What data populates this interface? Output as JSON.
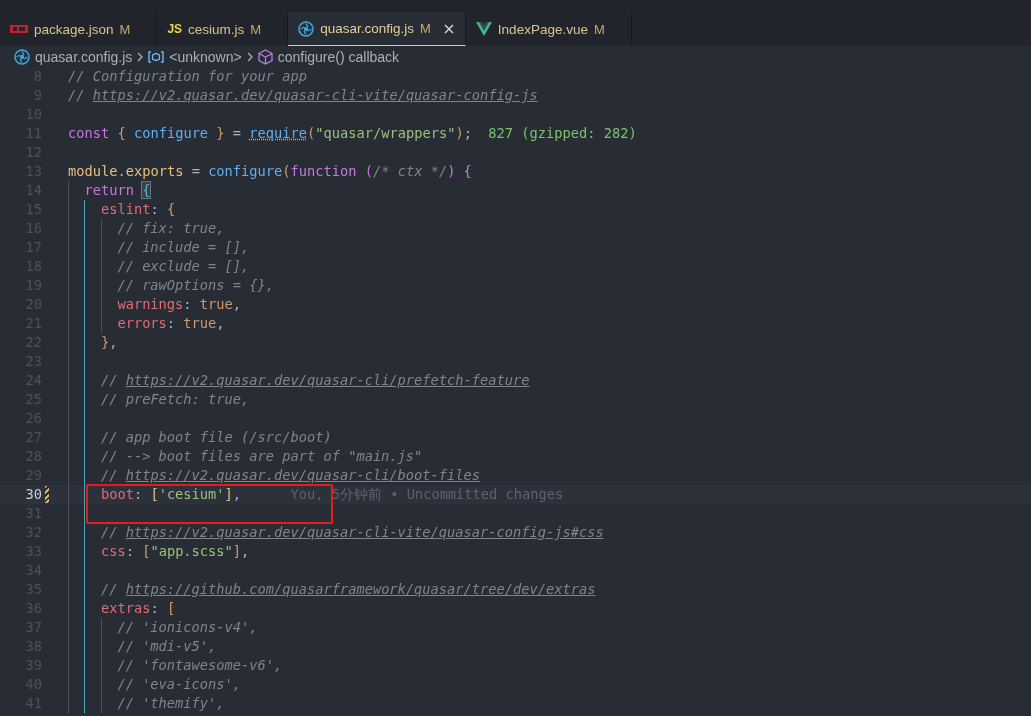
{
  "tabs": [
    {
      "label": "package.json",
      "status": "M",
      "kind": "package",
      "selected": false
    },
    {
      "label": "cesium.js",
      "status": "M",
      "kind": "js",
      "icon_text": "JS",
      "selected": false
    },
    {
      "label": "quasar.config.js",
      "status": "M",
      "kind": "swirl",
      "selected": true
    },
    {
      "label": "IndexPage.vue",
      "status": "M",
      "kind": "vue",
      "selected": false
    }
  ],
  "breadcrumb": [
    {
      "label": "quasar.config.js",
      "kind": "swirl"
    },
    {
      "label": "<unknown>",
      "kind": "variable"
    },
    {
      "label": "configure() callback",
      "kind": "cube"
    }
  ],
  "lines": [
    {
      "number": "8",
      "tokens": [
        {
          "text": "// Configuration for your app",
          "kind": "cmt"
        }
      ],
      "current": false,
      "modified": false,
      "boxed": false
    },
    {
      "number": "9",
      "tokens": [
        {
          "text": "// ",
          "kind": "cmt"
        },
        {
          "text": "https://v2.quasar.dev/quasar-cli-vite/quasar-config-js",
          "kind": "link"
        }
      ],
      "current": false,
      "modified": false,
      "boxed": false
    },
    {
      "number": "10",
      "current": false,
      "modified": false,
      "boxed": false
    },
    {
      "number": "11",
      "tokens": [
        {
          "text": "const ",
          "kind": "kw"
        },
        {
          "text": "{",
          "kind": "br1"
        },
        {
          "text": " configure ",
          "kind": "var"
        },
        {
          "text": "}",
          "kind": "br1"
        },
        {
          "text": " = ",
          "kind": "punc"
        },
        {
          "text": "require",
          "kind": "fnhint"
        },
        {
          "text": "(",
          "kind": "br1"
        },
        {
          "text": "\"quasar/wrappers\"",
          "kind": "str"
        },
        {
          "text": ")",
          "kind": "br1"
        },
        {
          "text": ";",
          "kind": "punc"
        }
      ],
      "annotation": {
        "text": "827 (gzipped: 282)",
        "kind": "size"
      },
      "current": false,
      "modified": false,
      "boxed": false
    },
    {
      "number": "12",
      "current": false,
      "modified": false,
      "boxed": false
    },
    {
      "number": "13",
      "tokens": [
        {
          "text": "module",
          "kind": "obj"
        },
        {
          "text": ".",
          "kind": "punc"
        },
        {
          "text": "exports",
          "kind": "obj"
        },
        {
          "text": " = ",
          "kind": "punc"
        },
        {
          "text": "configure",
          "kind": "fn"
        },
        {
          "text": "(",
          "kind": "br1"
        },
        {
          "text": "function ",
          "kind": "kw"
        },
        {
          "text": "(",
          "kind": "br2"
        },
        {
          "text": "/* ctx */",
          "kind": "cmt"
        },
        {
          "text": ") {",
          "kind": "br2"
        }
      ],
      "current": false,
      "modified": false,
      "boxed": false
    },
    {
      "number": "14",
      "guides": [
        {
          "kind": "outer"
        }
      ],
      "tokens": [
        {
          "text": "return ",
          "kind": "kw"
        },
        {
          "text": "{",
          "kind": "brmatch"
        }
      ],
      "current": false,
      "modified": false,
      "boxed": false
    },
    {
      "number": "15",
      "guides": [
        {
          "kind": "outer"
        },
        {
          "kind": "active"
        }
      ],
      "tokens": [
        {
          "text": "eslint",
          "kind": "prop"
        },
        {
          "text": ": ",
          "kind": "punc"
        },
        {
          "text": "{",
          "kind": "br1"
        }
      ],
      "current": false,
      "modified": false,
      "boxed": false
    },
    {
      "number": "16",
      "guides": [
        {
          "kind": "outer"
        },
        {
          "kind": "active"
        },
        {
          "kind": "inner"
        }
      ],
      "tokens": [
        {
          "text": "// fix: true,",
          "kind": "cmt"
        }
      ],
      "current": false,
      "modified": false,
      "boxed": false
    },
    {
      "number": "17",
      "guides": [
        {
          "kind": "outer"
        },
        {
          "kind": "active"
        },
        {
          "kind": "inner"
        }
      ],
      "tokens": [
        {
          "text": "// include = [],",
          "kind": "cmt"
        }
      ],
      "current": false,
      "modified": false,
      "boxed": false
    },
    {
      "number": "18",
      "guides": [
        {
          "kind": "outer"
        },
        {
          "kind": "active"
        },
        {
          "kind": "inner"
        }
      ],
      "tokens": [
        {
          "text": "// exclude = [],",
          "kind": "cmt"
        }
      ],
      "current": false,
      "modified": false,
      "boxed": false
    },
    {
      "number": "19",
      "guides": [
        {
          "kind": "outer"
        },
        {
          "kind": "active"
        },
        {
          "kind": "inner"
        }
      ],
      "tokens": [
        {
          "text": "// rawOptions = {},",
          "kind": "cmt"
        }
      ],
      "current": false,
      "modified": false,
      "boxed": false
    },
    {
      "number": "20",
      "guides": [
        {
          "kind": "outer"
        },
        {
          "kind": "active"
        },
        {
          "kind": "inner"
        }
      ],
      "tokens": [
        {
          "text": "warnings",
          "kind": "prop"
        },
        {
          "text": ": ",
          "kind": "punc"
        },
        {
          "text": "true",
          "kind": "bool"
        },
        {
          "text": ",",
          "kind": "punc"
        }
      ],
      "current": false,
      "modified": false,
      "boxed": false
    },
    {
      "number": "21",
      "guides": [
        {
          "kind": "outer"
        },
        {
          "kind": "active"
        },
        {
          "kind": "inner"
        }
      ],
      "tokens": [
        {
          "text": "errors",
          "kind": "prop"
        },
        {
          "text": ": ",
          "kind": "punc"
        },
        {
          "text": "true",
          "kind": "bool"
        },
        {
          "text": ",",
          "kind": "punc"
        }
      ],
      "current": false,
      "modified": false,
      "boxed": false
    },
    {
      "number": "22",
      "guides": [
        {
          "kind": "outer"
        },
        {
          "kind": "active"
        }
      ],
      "tokens": [
        {
          "text": "}",
          "kind": "br1"
        },
        {
          "text": ",",
          "kind": "punc"
        }
      ],
      "current": false,
      "modified": false,
      "boxed": false
    },
    {
      "number": "23",
      "guides": [
        {
          "kind": "outer"
        },
        {
          "kind": "active"
        }
      ],
      "current": false,
      "modified": false,
      "boxed": false
    },
    {
      "number": "24",
      "guides": [
        {
          "kind": "outer"
        },
        {
          "kind": "active"
        }
      ],
      "tokens": [
        {
          "text": "// ",
          "kind": "cmt"
        },
        {
          "text": "https://v2.quasar.dev/quasar-cli/prefetch-feature",
          "kind": "link"
        }
      ],
      "current": false,
      "modified": false,
      "boxed": false
    },
    {
      "number": "25",
      "guides": [
        {
          "kind": "outer"
        },
        {
          "kind": "active"
        }
      ],
      "tokens": [
        {
          "text": "// preFetch: true,",
          "kind": "cmt"
        }
      ],
      "current": false,
      "modified": false,
      "boxed": false
    },
    {
      "number": "26",
      "guides": [
        {
          "kind": "outer"
        },
        {
          "kind": "active"
        }
      ],
      "current": false,
      "modified": false,
      "boxed": false
    },
    {
      "number": "27",
      "guides": [
        {
          "kind": "outer"
        },
        {
          "kind": "active"
        }
      ],
      "tokens": [
        {
          "text": "// app boot file (/src/boot)",
          "kind": "cmt"
        }
      ],
      "current": false,
      "modified": false,
      "boxed": false
    },
    {
      "number": "28",
      "guides": [
        {
          "kind": "outer"
        },
        {
          "kind": "active"
        }
      ],
      "tokens": [
        {
          "text": "// --> boot files are part of \"main.js\"",
          "kind": "cmt"
        }
      ],
      "current": false,
      "modified": false,
      "boxed": false
    },
    {
      "number": "29",
      "guides": [
        {
          "kind": "outer"
        },
        {
          "kind": "active"
        }
      ],
      "tokens": [
        {
          "text": "// ",
          "kind": "cmt"
        },
        {
          "text": "https://v2.quasar.dev/quasar-cli/boot-files",
          "kind": "link"
        }
      ],
      "current": false,
      "modified": false,
      "boxed": false
    },
    {
      "number": "30",
      "guides": [
        {
          "kind": "outer"
        },
        {
          "kind": "active"
        }
      ],
      "tokens": [
        {
          "text": "boot",
          "kind": "prop"
        },
        {
          "text": ": ",
          "kind": "punc"
        },
        {
          "text": "[",
          "kind": "br3"
        },
        {
          "text": "'cesium'",
          "kind": "str"
        },
        {
          "text": "]",
          "kind": "br3"
        },
        {
          "text": ",",
          "kind": "punc"
        }
      ],
      "annotation": {
        "text": "You, 5分钟前 • Uncommitted changes",
        "kind": "blame"
      },
      "current": true,
      "modified": true,
      "boxed": true
    },
    {
      "number": "31",
      "guides": [
        {
          "kind": "outer"
        },
        {
          "kind": "active"
        }
      ],
      "current": false,
      "modified": false,
      "boxed": false
    },
    {
      "number": "32",
      "guides": [
        {
          "kind": "outer"
        },
        {
          "kind": "active"
        }
      ],
      "tokens": [
        {
          "text": "// ",
          "kind": "cmt"
        },
        {
          "text": "https://v2.quasar.dev/quasar-cli-vite/quasar-config-js#css",
          "kind": "link"
        }
      ],
      "current": false,
      "modified": false,
      "boxed": false
    },
    {
      "number": "33",
      "guides": [
        {
          "kind": "outer"
        },
        {
          "kind": "active"
        }
      ],
      "tokens": [
        {
          "text": "css",
          "kind": "prop"
        },
        {
          "text": ": ",
          "kind": "punc"
        },
        {
          "text": "[",
          "kind": "br1"
        },
        {
          "text": "\"app.scss\"",
          "kind": "str"
        },
        {
          "text": "]",
          "kind": "br1"
        },
        {
          "text": ",",
          "kind": "punc"
        }
      ],
      "current": false,
      "modified": false,
      "boxed": false
    },
    {
      "number": "34",
      "guides": [
        {
          "kind": "outer"
        },
        {
          "kind": "active"
        }
      ],
      "current": false,
      "modified": false,
      "boxed": false
    },
    {
      "number": "35",
      "guides": [
        {
          "kind": "outer"
        },
        {
          "kind": "active"
        }
      ],
      "tokens": [
        {
          "text": "// ",
          "kind": "cmt"
        },
        {
          "text": "https://github.com/quasarframework/quasar/tree/dev/extras",
          "kind": "link"
        }
      ],
      "current": false,
      "modified": false,
      "boxed": false
    },
    {
      "number": "36",
      "guides": [
        {
          "kind": "outer"
        },
        {
          "kind": "active"
        }
      ],
      "tokens": [
        {
          "text": "extras",
          "kind": "prop"
        },
        {
          "text": ": ",
          "kind": "punc"
        },
        {
          "text": "[",
          "kind": "br1"
        }
      ],
      "current": false,
      "modified": false,
      "boxed": false
    },
    {
      "number": "37",
      "guides": [
        {
          "kind": "outer"
        },
        {
          "kind": "active"
        },
        {
          "kind": "inner"
        }
      ],
      "tokens": [
        {
          "text": "// 'ionicons-v4',",
          "kind": "cmt"
        }
      ],
      "current": false,
      "modified": false,
      "boxed": false
    },
    {
      "number": "38",
      "guides": [
        {
          "kind": "outer"
        },
        {
          "kind": "active"
        },
        {
          "kind": "inner"
        }
      ],
      "tokens": [
        {
          "text": "// 'mdi-v5',",
          "kind": "cmt"
        }
      ],
      "current": false,
      "modified": false,
      "boxed": false
    },
    {
      "number": "39",
      "guides": [
        {
          "kind": "outer"
        },
        {
          "kind": "active"
        },
        {
          "kind": "inner"
        }
      ],
      "tokens": [
        {
          "text": "// 'fontawesome-v6',",
          "kind": "cmt"
        }
      ],
      "current": false,
      "modified": false,
      "boxed": false
    },
    {
      "number": "40",
      "guides": [
        {
          "kind": "outer"
        },
        {
          "kind": "active"
        },
        {
          "kind": "inner"
        }
      ],
      "tokens": [
        {
          "text": "// 'eva-icons',",
          "kind": "cmt"
        }
      ],
      "current": false,
      "modified": false,
      "boxed": false
    },
    {
      "number": "41",
      "guides": [
        {
          "kind": "outer"
        },
        {
          "kind": "active"
        },
        {
          "kind": "inner"
        }
      ],
      "tokens": [
        {
          "text": "// 'themify',",
          "kind": "cmt"
        }
      ],
      "current": false,
      "modified": false,
      "boxed": false
    }
  ]
}
